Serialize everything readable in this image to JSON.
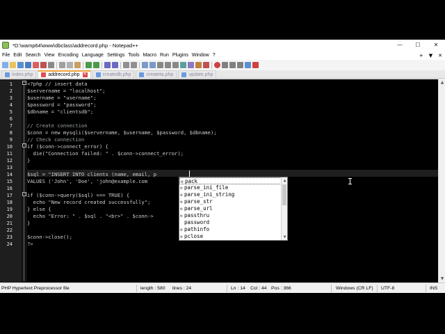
{
  "window": {
    "title": "*D:\\wamp64\\www\\dbclass\\addrecord.php - Notepad++",
    "buttons": {
      "minimize": "—",
      "maximize": "☐",
      "close": "✕"
    }
  },
  "menu": {
    "items": [
      "File",
      "Edit",
      "Search",
      "View",
      "Encoding",
      "Language",
      "Settings",
      "Tools",
      "Macro",
      "Run",
      "Plugins",
      "Window",
      "?"
    ],
    "right": [
      "+",
      "▼",
      "✕"
    ]
  },
  "tabs": [
    {
      "label": "index.php",
      "active": false
    },
    {
      "label": "addrecord.php",
      "active": true
    },
    {
      "label": "createdb.php",
      "active": false
    },
    {
      "label": "createta.php",
      "active": false
    },
    {
      "label": "update.php",
      "active": false
    }
  ],
  "editor": {
    "line_numbers": [
      "1",
      "2",
      "3",
      "4",
      "5",
      "6",
      "7",
      "8",
      "9",
      "10",
      "11",
      "12",
      "13",
      "14",
      "15",
      "16",
      "17",
      "18",
      "19",
      "20",
      "21",
      "22",
      "23",
      "24"
    ],
    "lines": [
      "<?php // insert data",
      "$servername = \"localhost\";",
      "$username = \"username\";",
      "$password = \"password\";",
      "$dbname = \"clientsdb\";",
      "",
      "// Create connection",
      "$conn = new mysqli($servername, $username, $password, $dbname);",
      "// Check connection",
      "if ($conn->connect_error) {",
      "  die(\"Connection failed: \" . $conn->connect_error);",
      "}",
      "",
      "$sql = \"INSERT INTO clients (name, email, p",
      "VALUES ('John', 'Doe', 'john@example.com",
      "",
      "if ($conn->query($sql) === TRUE) {",
      "  echo \"New record created successfully\";",
      "} else {",
      "  echo \"Error: \" . $sql . \"<br>\" . $conn->",
      "}",
      "",
      "$conn->close();",
      "?>"
    ]
  },
  "autocomplete": {
    "items": [
      "pack",
      "parse_ini_file",
      "parse_ini_string",
      "parse_str",
      "parse_url",
      "passthru",
      "password",
      "pathinfo",
      "pclose"
    ],
    "selected_index": 0
  },
  "statusbar": {
    "language": "PHP Hypertext Preprocessor file",
    "length": "length : 580",
    "lines": "lines : 24",
    "ln": "Ln : 14",
    "col": "Col : 44",
    "pos": "Pos : 366",
    "eol": "Windows (CR LF)",
    "encoding": "UTF-8",
    "mode": "INS"
  },
  "colors": {
    "editor_bg": "#000000",
    "tab_accent": "#f2a33c",
    "chrome_bg": "#f0f0f0"
  }
}
